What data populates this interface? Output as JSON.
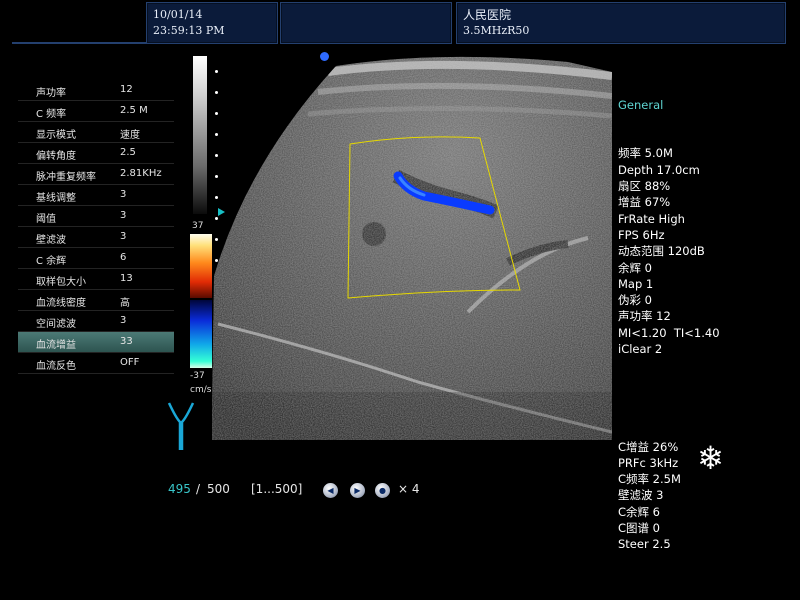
{
  "header": {
    "date": "10/01/14",
    "time": "23:59:13 PM",
    "hospital": "人民医院",
    "probe": "3.5MHzR50"
  },
  "params": [
    {
      "label": "声功率",
      "value": "12"
    },
    {
      "label": "C 频率",
      "value": "2.5 M"
    },
    {
      "label": "显示模式",
      "value": "速度"
    },
    {
      "label": "偏转角度",
      "value": "2.5"
    },
    {
      "label": "脉冲重复频率",
      "value": "2.81KHz"
    },
    {
      "label": "基线调整",
      "value": "3"
    },
    {
      "label": "阈值",
      "value": "3"
    },
    {
      "label": "壁滤波",
      "value": "3"
    },
    {
      "label": "C 余辉",
      "value": "6"
    },
    {
      "label": "取样包大小",
      "value": "13"
    },
    {
      "label": "血流线密度",
      "value": "高"
    },
    {
      "label": "空间滤波",
      "value": "3"
    },
    {
      "label": "血流增益",
      "value": "33"
    },
    {
      "label": "血流反色",
      "value": "OFF"
    }
  ],
  "selected_param": "血流增益",
  "info": {
    "preset": "General",
    "bmode": [
      "频率 5.0M",
      "Depth 17.0cm",
      "扇区 88%",
      "增益 67%",
      "FrRate High",
      "FPS 6Hz",
      "动态范围 120dB",
      "余辉 0",
      "Map 1",
      "伪彩 0",
      "声功率 12",
      "MI<1.20  TI<1.40",
      "iClear 2"
    ],
    "color": [
      "C增益 26%",
      "PRFc 3kHz",
      "C频率 2.5M",
      "壁滤波 3",
      "C余辉 6",
      "C图谱 0",
      "Steer 2.5"
    ]
  },
  "scale": {
    "top": "37",
    "bottom": "-37",
    "unit": "cm/s"
  },
  "footer": {
    "frame_current": "495",
    "separator": "/",
    "frame_total": "500",
    "range": "[1...500]",
    "speed": "× 4"
  },
  "icons": {
    "freeze": "snowflake-icon",
    "probe": "probe-vessel-icon"
  },
  "colors": {
    "accent": "#5fd5d2",
    "panel": "#0b1b3a",
    "selected_row": "#3f6d69",
    "roi": "#e6d800"
  }
}
